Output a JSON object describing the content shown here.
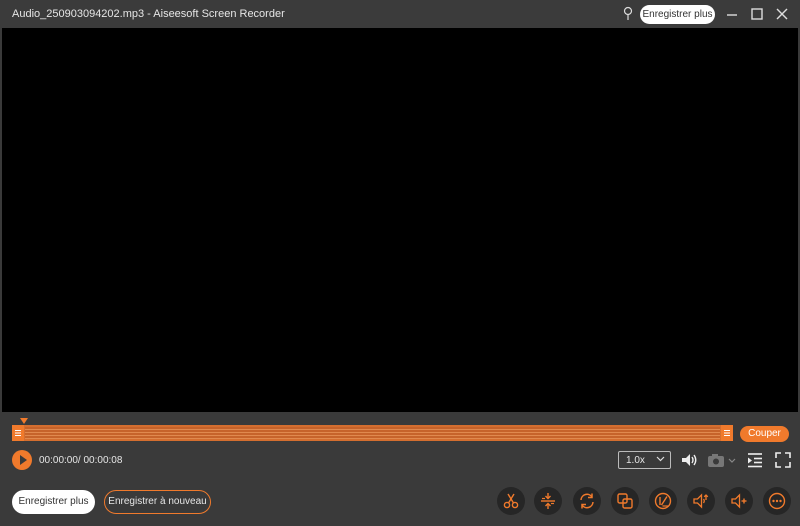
{
  "window": {
    "title": "Audio_250903094202.mp3  -  Aiseesoft Screen Recorder",
    "register_more_label": "Enregistrer plus"
  },
  "player": {
    "cut_label": "Couper",
    "time": "00:00:00/ 00:00:08",
    "speed": "1.0x"
  },
  "bottom": {
    "register_more_label": "Enregistrer plus",
    "register_again_label": "Enregistrer à nouveau"
  },
  "icons": {
    "pin": "pin-icon",
    "minimize": "minimize-icon",
    "maximize": "maximize-icon",
    "close": "close-icon",
    "play": "play-icon",
    "volume": "volume-icon",
    "camera": "camera-icon",
    "playlist": "playlist-icon",
    "fullscreen": "fullscreen-icon",
    "tools": [
      "scissors-icon",
      "split-icon",
      "rotate-icon",
      "merge-icon",
      "edit-metadata-icon",
      "volume-boost-icon",
      "audio-add-icon",
      "more-icon"
    ]
  },
  "colors": {
    "accent": "#f07a2c",
    "background": "#3a3a3a",
    "video": "#000000"
  }
}
